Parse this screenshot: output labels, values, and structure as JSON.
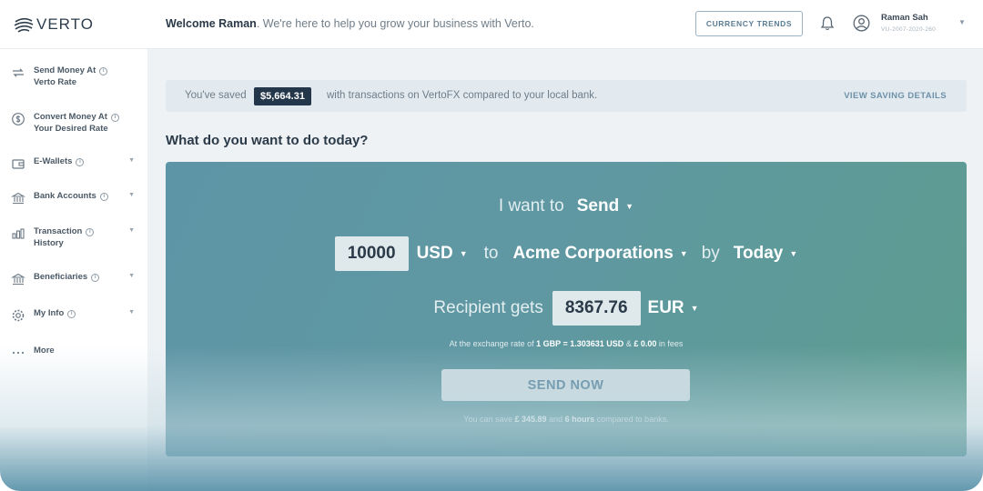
{
  "brand": {
    "name": "VERTO"
  },
  "header": {
    "welcome_name": "Welcome Raman",
    "welcome_text": ". We're here to help you grow your business with Verto.",
    "currency_trends": "CURRENCY TRENDS",
    "user_name": "Raman Sah",
    "user_id": "VU-2007-2020-260"
  },
  "sidebar": {
    "items": [
      {
        "label1": "Send Money At",
        "label2": "Verto Rate",
        "icon": "transfer-icon",
        "has_info": true,
        "has_caret": false
      },
      {
        "label1": "Convert Money At",
        "label2": "Your Desired Rate",
        "icon": "convert-icon",
        "has_info": true,
        "has_caret": false
      },
      {
        "label1": "E-Wallets",
        "label2": "",
        "icon": "wallet-icon",
        "has_info": true,
        "has_caret": true
      },
      {
        "label1": "Bank Accounts",
        "label2": "",
        "icon": "bank-icon",
        "has_info": true,
        "has_caret": true
      },
      {
        "label1": "Transaction",
        "label2": "History",
        "icon": "history-icon",
        "has_info": true,
        "has_caret": true
      },
      {
        "label1": "Beneficiaries",
        "label2": "",
        "icon": "beneficiaries-icon",
        "has_info": true,
        "has_caret": true
      },
      {
        "label1": "My Info",
        "label2": "",
        "icon": "gear-icon",
        "has_info": true,
        "has_caret": true
      },
      {
        "label1": "More",
        "label2": "",
        "icon": "more-icon",
        "has_info": false,
        "has_caret": false
      }
    ]
  },
  "savings": {
    "prefix": "You've saved",
    "amount": "$5,664.31",
    "suffix": "with transactions on VertoFX compared to your local bank.",
    "link": "VIEW SAVING DETAILS"
  },
  "main": {
    "question": "What do you want to do today?",
    "i_want_to": "I want to",
    "action": "Send",
    "amount": "10000",
    "from_currency": "USD",
    "to_word": "to",
    "recipient": "Acme Corporations",
    "by_word": "by",
    "timing": "Today",
    "recipient_gets": "Recipient gets",
    "converted_amount": "8367.76",
    "to_currency": "EUR",
    "rate_prefix": "At the exchange rate of",
    "rate_value": "1 GBP = 1.303631 USD",
    "rate_and": "&",
    "fee_value": "£ 0.00",
    "fee_suffix": "in fees",
    "send_button": "SEND NOW",
    "note_prefix": "You can save",
    "note_amount": "£ 345.89",
    "note_and": "and",
    "note_time": "6 hours",
    "note_suffix": "compared to banks."
  },
  "colors": {
    "panel_start": "#5e95a6",
    "panel_end": "#5d9c8f",
    "navy": "#23364a",
    "accent": "#6d91a9"
  }
}
